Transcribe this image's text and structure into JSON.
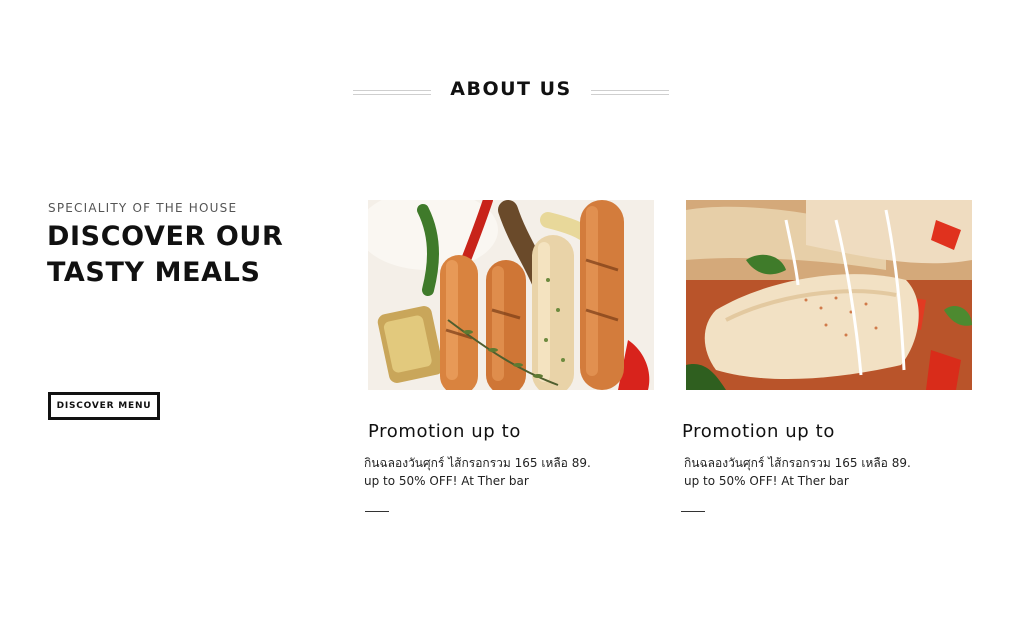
{
  "section": {
    "title": "ABOUT US"
  },
  "intro": {
    "eyebrow": "SPECIALITY OF THE HOUSE",
    "headline_line1": "DISCOVER OUR",
    "headline_line2": "TASTY MEALS",
    "button_label": "DISCOVER MENU"
  },
  "cards": [
    {
      "image": "grilled-sausages-photo",
      "title": "Promotion up to",
      "line1": "กินฉลองวันศุกร์ ไส้กรอกรวม 165 เหลือ 89.",
      "line2": "up to 50% OFF! At Ther bar"
    },
    {
      "image": "crepe-wrap-photo",
      "title": "Promotion up to",
      "line1": "กินฉลองวันศุกร์ ไส้กรอกรวม 165 เหลือ 89.",
      "line2": "up to 50% OFF! At Ther bar"
    }
  ],
  "colors": {
    "text": "#111111",
    "rule": "#cfcfcf",
    "background": "#ffffff"
  }
}
